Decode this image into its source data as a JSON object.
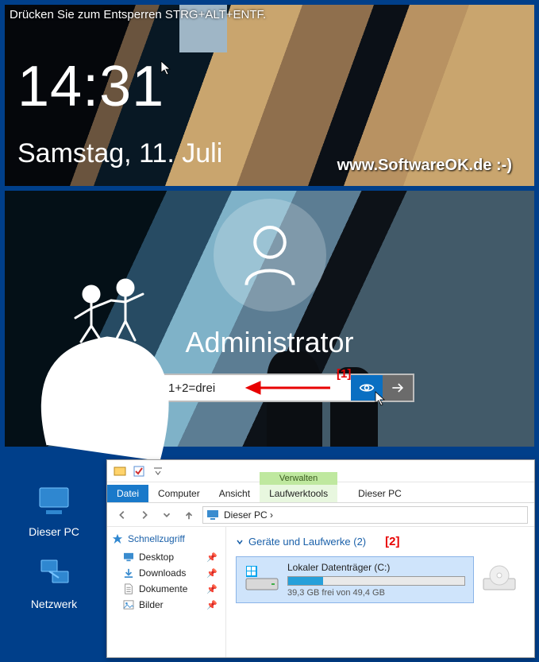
{
  "lock": {
    "hint": "Drücken Sie zum Entsperren STRG+ALT+ENTF.",
    "time": "14:31",
    "date": "Samstag, 11. Juli",
    "watermark": "www.SoftwareOK.de :-)"
  },
  "login": {
    "user": "Administrator",
    "password_value": "1+2=drei",
    "annot1": "[1]"
  },
  "desktop": {
    "this_pc": "Dieser PC",
    "network": "Netzwerk"
  },
  "explorer": {
    "context_label": "Verwalten",
    "tabs": {
      "file": "Datei",
      "computer": "Computer",
      "view": "Ansicht",
      "tools": "Laufwerktools"
    },
    "location_label": "Dieser PC",
    "breadcrumb": "Dieser PC  ›",
    "sidebar": {
      "quick": "Schnellzugriff",
      "items": [
        {
          "label": "Desktop"
        },
        {
          "label": "Downloads"
        },
        {
          "label": "Dokumente"
        },
        {
          "label": "Bilder"
        }
      ]
    },
    "group_heading": "Geräte und Laufwerke (2)",
    "annot2": "[2]",
    "drive": {
      "name": "Lokaler Datenträger (C:)",
      "free_text": "39,3 GB frei von 49,4 GB",
      "fill_percent": 20
    }
  }
}
